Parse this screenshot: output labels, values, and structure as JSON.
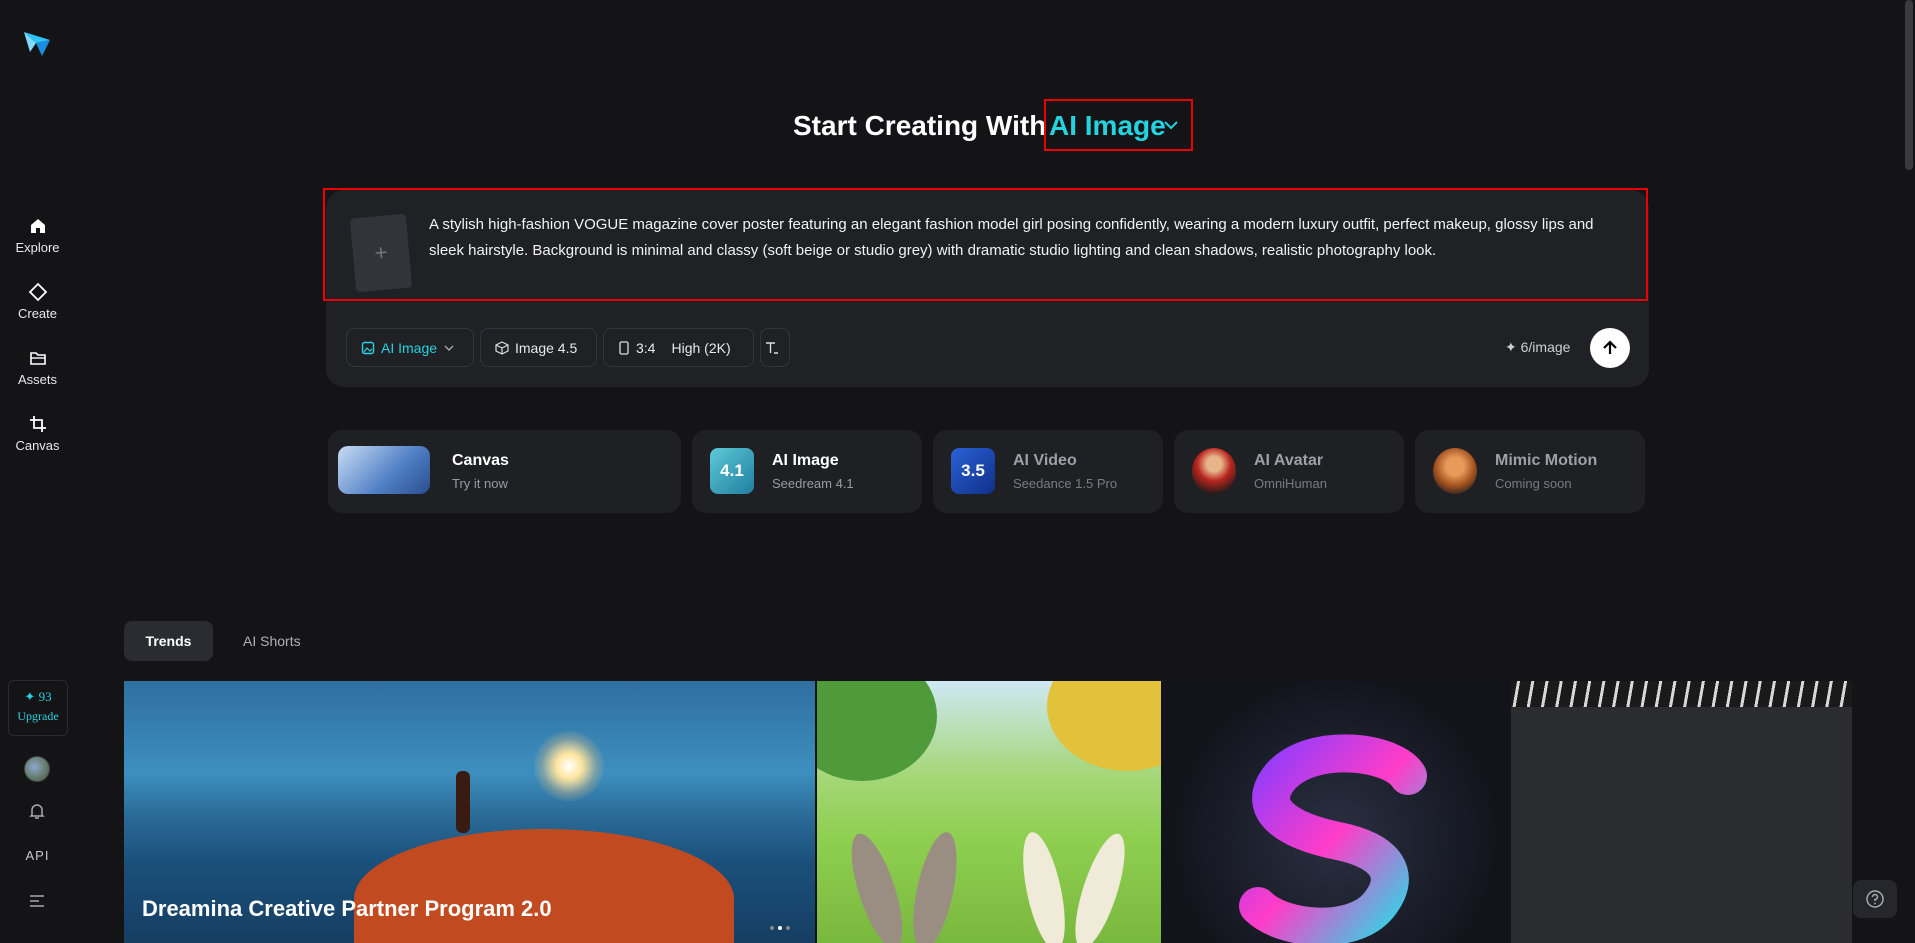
{
  "sidebar": {
    "items": [
      {
        "label": "Explore",
        "icon": "home-icon"
      },
      {
        "label": "Create",
        "icon": "diamond-icon"
      },
      {
        "label": "Assets",
        "icon": "folder-icon"
      },
      {
        "label": "Canvas",
        "icon": "crop-icon"
      }
    ],
    "credits": "93",
    "upgrade_label": "Upgrade",
    "api_label": "API"
  },
  "hero": {
    "prefix": "Start Creating With",
    "mode": "AI Image"
  },
  "prompt": {
    "text": "A stylish high-fashion VOGUE magazine cover poster featuring an elegant fashion model girl posing confidently, wearing a modern luxury outfit, perfect makeup, glossy lips and sleek hairstyle. Background is minimal and classy (soft beige or studio grey) with dramatic studio lighting and clean shadows, realistic photography look.",
    "upload_symbol": "+"
  },
  "toolbar": {
    "mode_label": "AI Image",
    "model_label": "Image 4.5",
    "ratio_label": "3:4",
    "quality_label": "High (2K)",
    "cost_label": "6/image"
  },
  "features": [
    {
      "title": "Canvas",
      "subtitle": "Try it now"
    },
    {
      "title": "AI Image",
      "subtitle": "Seedream 4.1",
      "badge": "4.1"
    },
    {
      "title": "AI Video",
      "subtitle": "Seedance 1.5 Pro",
      "badge": "3.5"
    },
    {
      "title": "AI Avatar",
      "subtitle": "OmniHuman"
    },
    {
      "title": "Mimic Motion",
      "subtitle": "Coming soon"
    }
  ],
  "tabs": [
    "Trends",
    "AI Shorts"
  ],
  "gallery": {
    "banner_title": "Dreamina Creative Partner Program 2.0"
  },
  "colors": {
    "accent": "#25d3e0",
    "background": "#141416",
    "panel": "#202125",
    "highlight": "#ee0000"
  }
}
